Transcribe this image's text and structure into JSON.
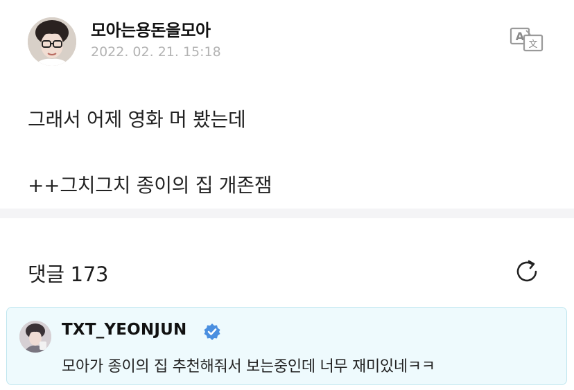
{
  "post": {
    "author_name": "모아는용돈을모아",
    "date": "2022. 02. 21. 15:18",
    "body_lines": [
      "그래서 어제 영화 머 봤는데",
      "++그치그치 종이의 집 개존잼"
    ]
  },
  "comments": {
    "label": "댓글 173"
  },
  "highlighted_comment": {
    "author": "TXT_YEONJUN",
    "text": "모아가 종이의 집 추천해줘서 보는중인데 너무 재미있네ㅋㅋ"
  },
  "icons": {
    "translate": "translate-icon",
    "refresh": "refresh-icon",
    "verified": "verified-badge-icon"
  },
  "colors": {
    "verified_blue": "#4a8fe0",
    "comment_card_bg": "#eefafd",
    "comment_card_border": "#bfe6ef",
    "date_gray": "#b3b3b3",
    "divider": "#f4f4f6"
  }
}
